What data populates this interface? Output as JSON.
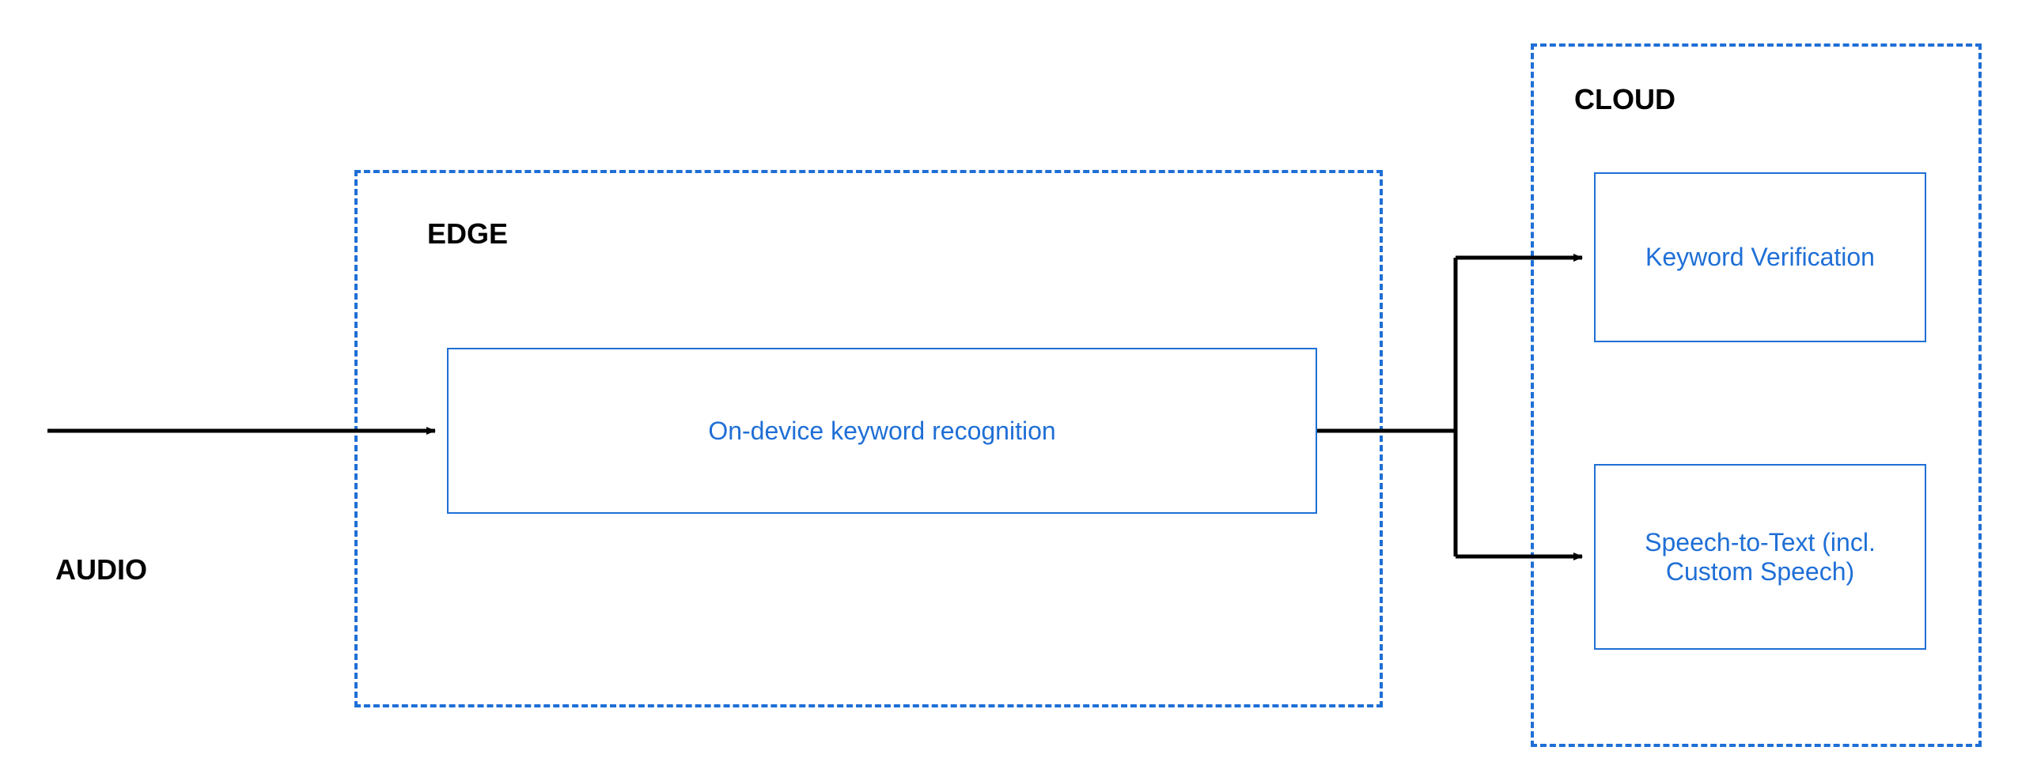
{
  "labels": {
    "audio": "AUDIO",
    "edge": "EDGE",
    "cloud": "CLOUD"
  },
  "boxes": {
    "edge_main": "On-device keyword recognition",
    "cloud_top": "Keyword Verification",
    "cloud_bottom": "Speech-to-Text (incl. Custom Speech)"
  },
  "colors": {
    "blue": "#1f6fd6",
    "black": "#000000"
  }
}
